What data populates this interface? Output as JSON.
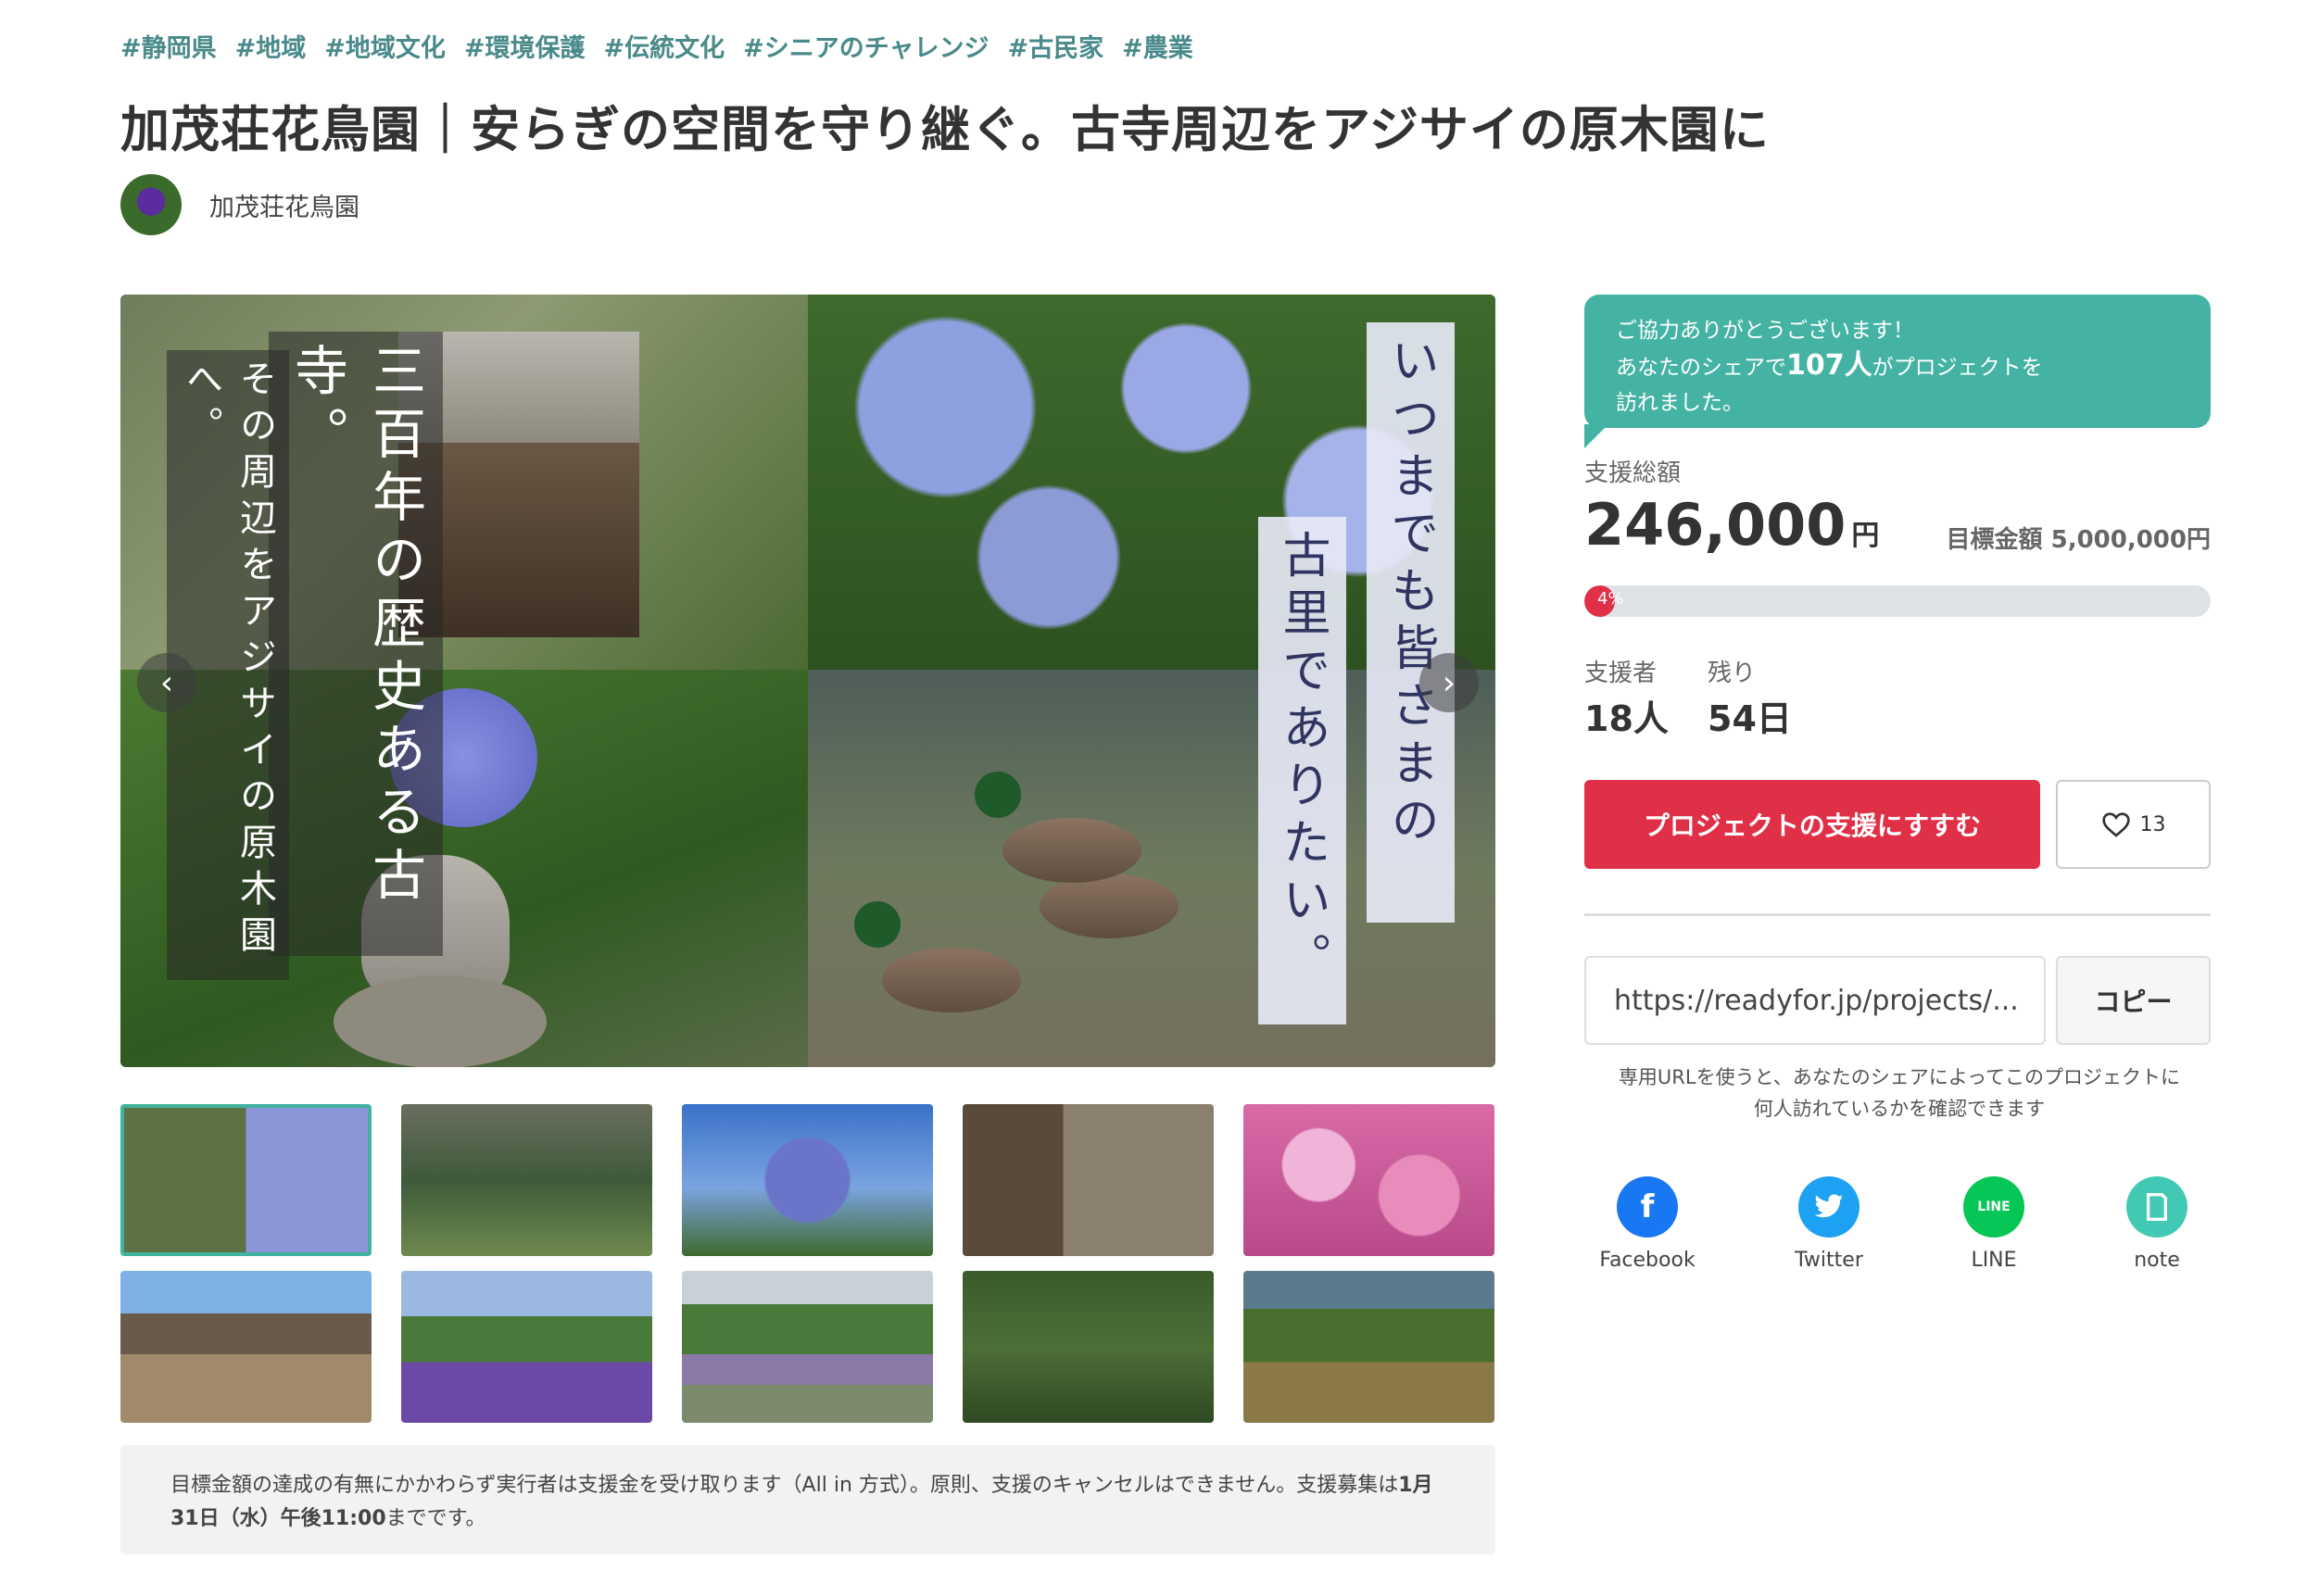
{
  "tags": [
    "#静岡県",
    "#地域",
    "#地域文化",
    "#環境保護",
    "#伝統文化",
    "#シニアのチャレンジ",
    "#古民家",
    "#農業"
  ],
  "title": "加茂荘花鳥園｜安らぎの空間を守り継ぐ。古寺周辺をアジサイの原木園に",
  "owner": {
    "name": "加茂荘花鳥園"
  },
  "hero": {
    "text_left_big": "三百年の歴史ある古寺。",
    "text_left_small": "その周辺をアジサイの原木園へ。",
    "text_right_1": "いつまでも皆さまの",
    "text_right_2": "古里でありたい。",
    "prev": "‹",
    "next": "›"
  },
  "notice": {
    "text1": "目標金額の達成の有無にかかわらず実行者は支援金を受け取ります（All in 方式）。原則、支援のキャンセルはできません。支援募集は",
    "deadline": "1月31日（水）午後11:00",
    "text2": "までです。"
  },
  "balloon": {
    "line1": "ご協力ありがとうございます！",
    "line2_pre": "あなたのシェアで",
    "line2_big": "107人",
    "line2_post": "がプロジェクトを",
    "line3": "訪れました。"
  },
  "funding": {
    "label": "支援総額",
    "amount": "246,000",
    "unit": "円",
    "goal": "目標金額 5,000,000円",
    "percent_text": "4%",
    "percent": 0.0492
  },
  "stats": {
    "supporters_label": "支援者",
    "supporters": "18人",
    "remaining_label": "残り",
    "remaining": "54日"
  },
  "buttons": {
    "support": "プロジェクトの支援にすすむ",
    "favorite_count": "13",
    "copy": "コピー"
  },
  "share_url": "https://readyfor.jp/projects/...",
  "url_note": "専用URLを使うと、あなたのシェアによってこのプロジェクトに何人訪れているかを確認できます",
  "share": [
    {
      "name": "Facebook",
      "color": "#1877f2",
      "icon": "facebook-icon",
      "glyph": "f"
    },
    {
      "name": "Twitter",
      "color": "#1da1f2",
      "icon": "twitter-icon",
      "glyph": "t"
    },
    {
      "name": "LINE",
      "color": "#06c755",
      "icon": "line-icon",
      "glyph": "LINE"
    },
    {
      "name": "note",
      "color": "#41c9b4",
      "icon": "note-icon",
      "glyph": "▯"
    }
  ],
  "colors": {
    "accent": "#e03048",
    "teal": "#45b3a3",
    "tag": "#4a8a8a"
  }
}
